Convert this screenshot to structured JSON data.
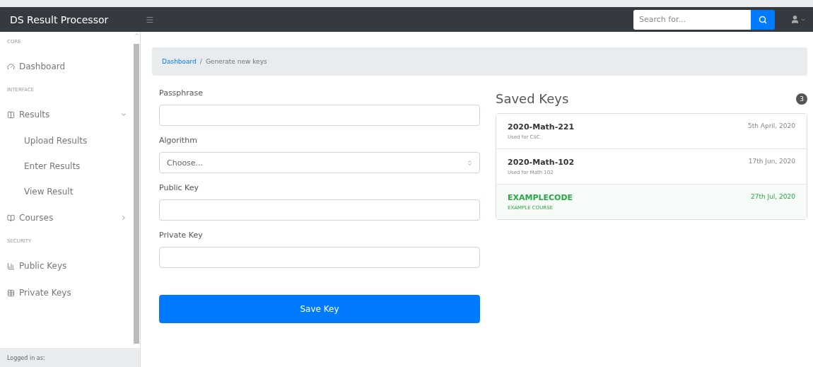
{
  "topbar": {
    "brand": "DS Result Processor",
    "search": {
      "placeholder": "Search for..."
    }
  },
  "sidebar": {
    "sections": [
      {
        "heading": "CORE",
        "items": [
          {
            "label": "Dashboard"
          }
        ]
      },
      {
        "heading": "INTERFACE",
        "items": [
          {
            "label": "Results",
            "expanded": true,
            "children": [
              {
                "label": "Upload Results"
              },
              {
                "label": "Enter Results"
              },
              {
                "label": "View Result"
              }
            ]
          },
          {
            "label": "Courses",
            "expanded": false
          }
        ]
      },
      {
        "heading": "SECURITY",
        "items": [
          {
            "label": "Public Keys"
          },
          {
            "label": "Private Keys"
          }
        ]
      }
    ],
    "footer": "Logged in as:"
  },
  "breadcrumb": {
    "separator": "/",
    "items": [
      {
        "label": "Dashboard",
        "kind": "link"
      },
      {
        "label": "Generate new keys",
        "kind": "current"
      }
    ]
  },
  "form": {
    "fields": [
      {
        "label": "Passphrase",
        "kind": "text"
      },
      {
        "label": "Algorithm",
        "kind": "select",
        "value": "Choose..."
      },
      {
        "label": "Public Key",
        "kind": "text"
      },
      {
        "label": "Private Key",
        "kind": "text"
      }
    ],
    "submit": "Save Key"
  },
  "saved_keys": {
    "title": "Saved Keys",
    "count": "3",
    "items": [
      {
        "code": "2020-Math-221",
        "note": "Used for CSC",
        "date": "5th April, 2020",
        "selected": false
      },
      {
        "code": "2020-Math-102",
        "note": "Used for Math 102",
        "date": "17th Jun, 2020",
        "selected": false
      },
      {
        "code": "EXAMPLECODE",
        "note": "EXAMPLE COURSE",
        "date": "27th Jul, 2020",
        "selected": true
      }
    ]
  }
}
